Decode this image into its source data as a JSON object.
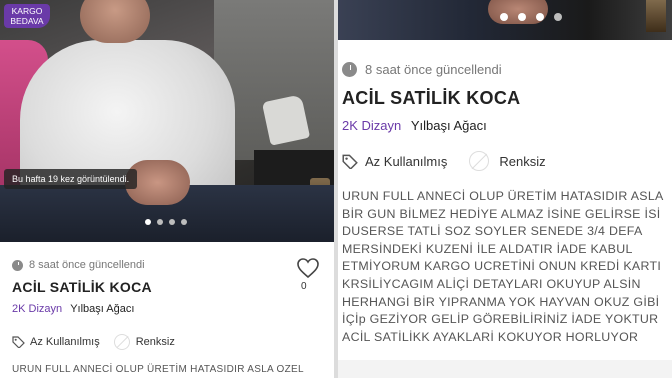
{
  "listing": {
    "kargo_badge": [
      "KARGO",
      "BEDAVA"
    ],
    "views_text": "Bu hafta 19 kez görüntülendi.",
    "updated": "8 saat önce güncellendi",
    "title": "ACİL SATİLİK KOCA",
    "shop": {
      "brand": "2K Dizayn",
      "category": "Yılbaşı Ağacı"
    },
    "condition": "Az Kullanılmış",
    "color": "Renksiz",
    "likes": "0",
    "description_left": "URUN FULL ANNECİ OLUP ÜRETİM HATASIDIR ASLA OZEL",
    "description_right": [
      "URUN FULL ANNECİ OLUP ÜRETİM HATASIDIR ASLA",
      "BİR GUN BİLMEZ HEDİYE ALMAZ İSİNE GELİRSE İSİ",
      "DUSERSE TATLİ SOZ SOYLER SENEDE 3/4 DEFA",
      "MERSİNDEKİ KUZENİ İLE ALDATIR İADE KABUL",
      "ETMİYORUM KARGO UCRETİNİ ONUN KREDİ KARTI",
      "KRSİLİYCAGIM ALİÇİ DETAYLARI OKUYUP ALSİN",
      "HERHANGİ BİR YIPRANMA YOK HAYVAN OKUZ GİBİ",
      "İÇİp GEZİYOR GELİP GÖREBİLİRİNİZ İADE YOKTUR",
      "ACİL SATİLİKK AYAKLARİ KOKUYOR HORLUYOR"
    ],
    "carousel": {
      "count": 4,
      "active_index": 0
    }
  },
  "colors": {
    "accent": "#6a3aa8",
    "text": "#222222",
    "muted": "#777777"
  },
  "icons": {
    "clock": "clock-icon",
    "tag": "tag-icon",
    "colorless": "colorless-icon",
    "heart": "heart-icon"
  }
}
